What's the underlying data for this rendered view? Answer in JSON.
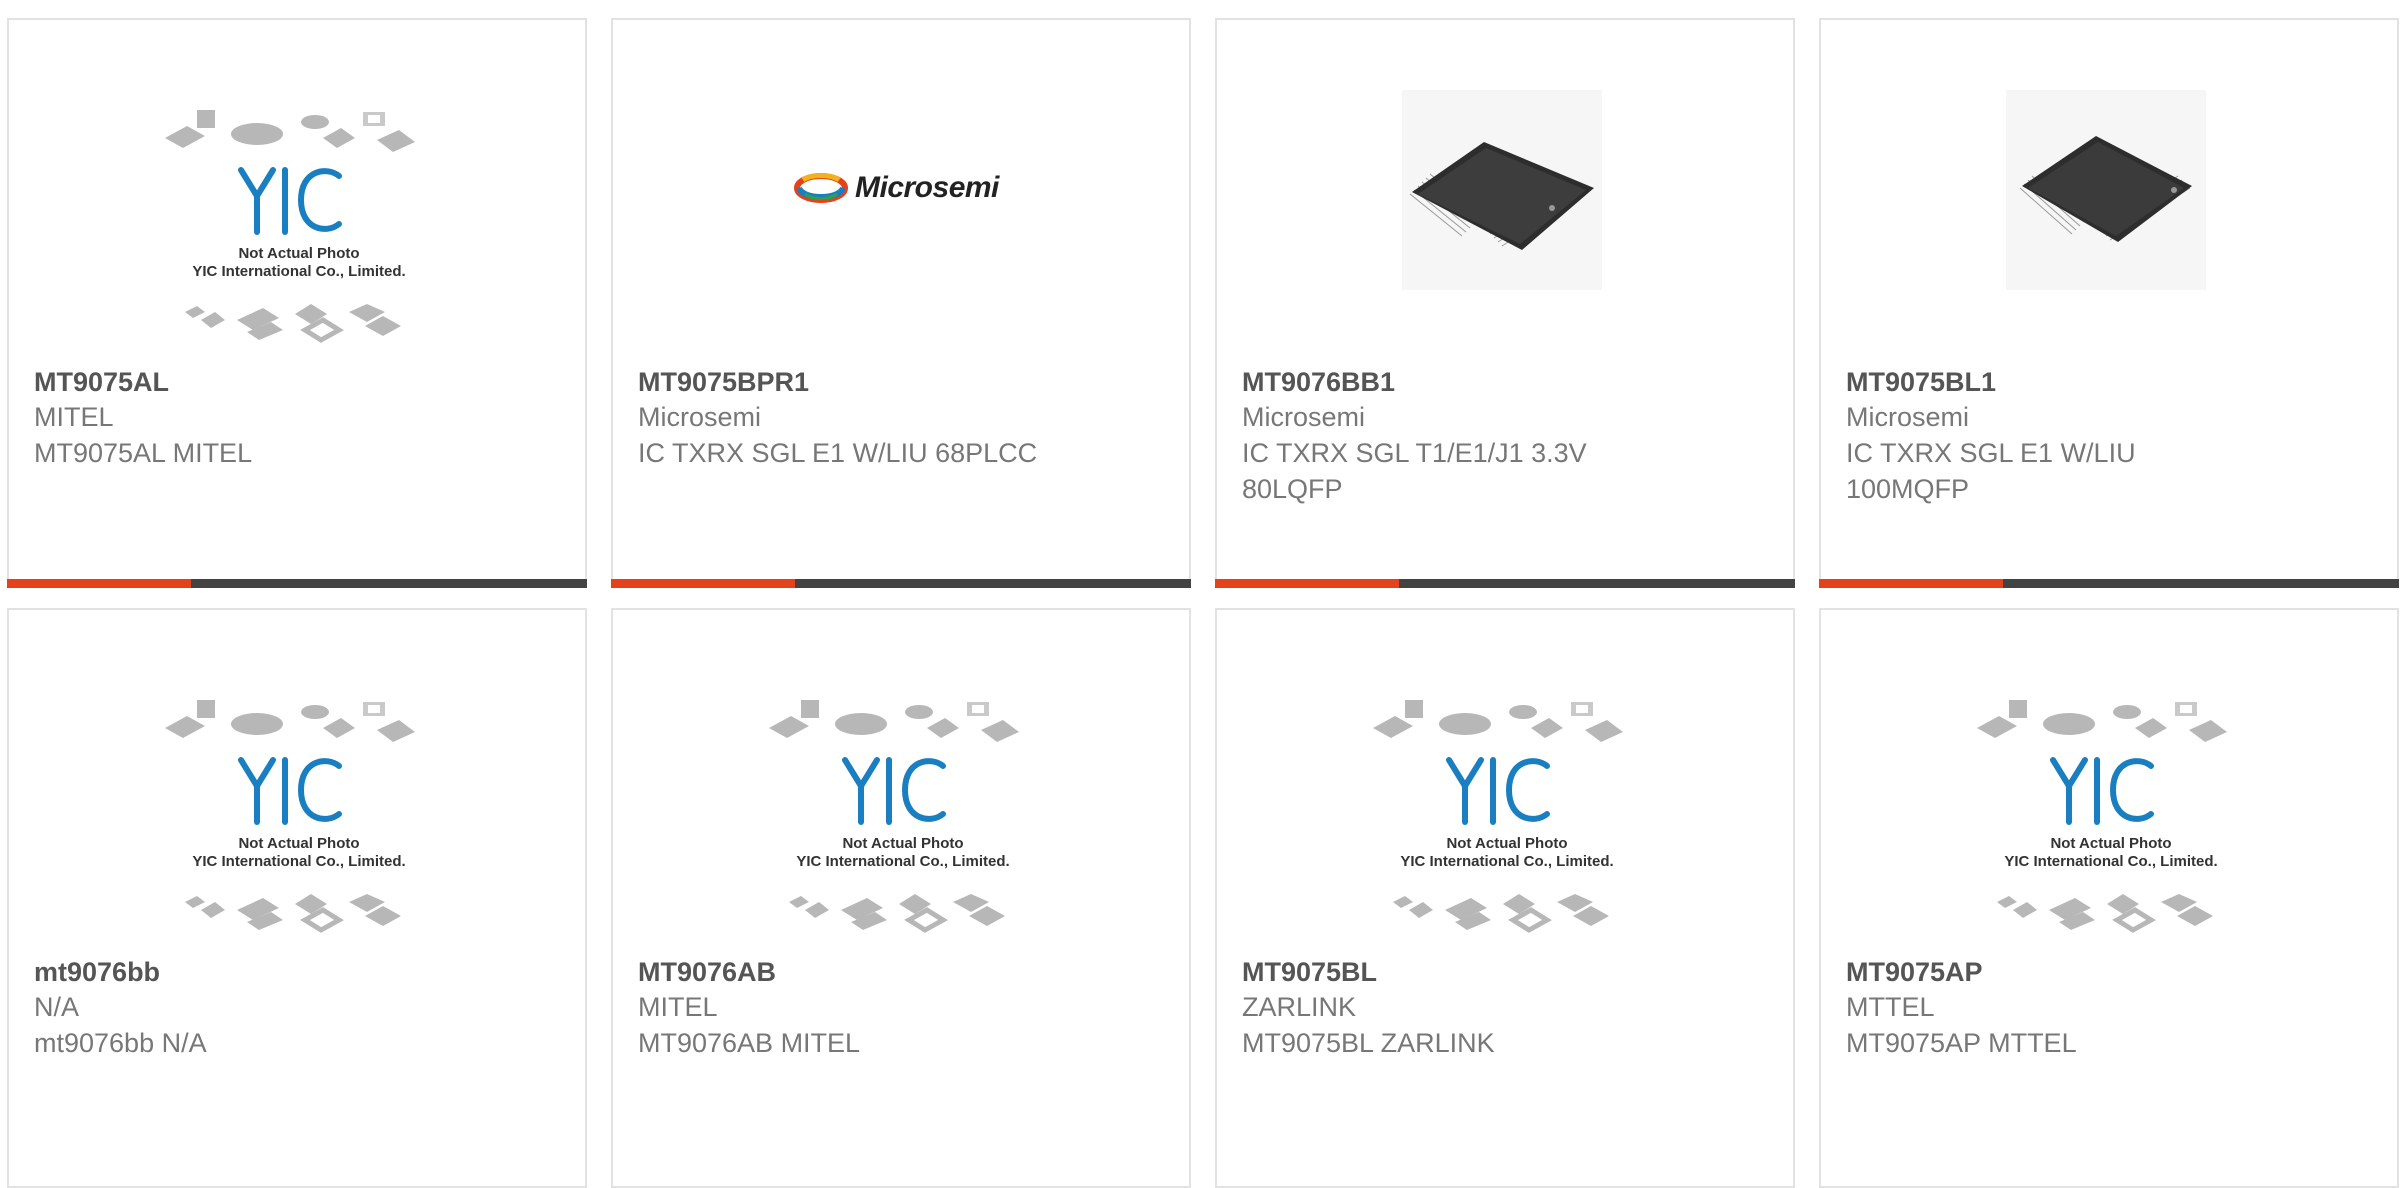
{
  "products": [
    {
      "part": "MT9075AL",
      "mfr": "MITEL",
      "desc": "MT9075AL MITEL",
      "image": "placeholder",
      "has_bar": true
    },
    {
      "part": "MT9075BPR1",
      "mfr": "Microsemi",
      "desc": "IC TXRX SGL E1 W/LIU 68PLCC",
      "image": "microsemi-logo",
      "has_bar": true
    },
    {
      "part": "MT9076BB1",
      "mfr": "Microsemi",
      "desc": "IC TXRX SGL T1/E1/J1 3.3V 80LQFP",
      "image": "chip-photo",
      "has_bar": true
    },
    {
      "part": "MT9075BL1",
      "mfr": "Microsemi",
      "desc": "IC TXRX SGL E1 W/LIU 100MQFP",
      "image": "chip-photo",
      "has_bar": true
    },
    {
      "part": "mt9076bb",
      "mfr": "N/A",
      "desc": "mt9076bb N/A",
      "image": "placeholder",
      "has_bar": false
    },
    {
      "part": "MT9076AB",
      "mfr": "MITEL",
      "desc": "MT9076AB MITEL",
      "image": "placeholder",
      "has_bar": false
    },
    {
      "part": "MT9075BL",
      "mfr": "ZARLINK",
      "desc": "MT9075BL ZARLINK",
      "image": "placeholder",
      "has_bar": false
    },
    {
      "part": "MT9075AP",
      "mfr": "MTTEL",
      "desc": "MT9075AP MTTEL",
      "image": "placeholder",
      "has_bar": false
    }
  ],
  "placeholder": {
    "brand": "YIC",
    "line1": "Not Actual Photo",
    "line2": "YIC International Co., Limited."
  },
  "logo_text": "Microsemi",
  "colors": {
    "accent": "#e5411a",
    "bar_dark": "#434343",
    "logo_blue": "#1a7fc1"
  }
}
